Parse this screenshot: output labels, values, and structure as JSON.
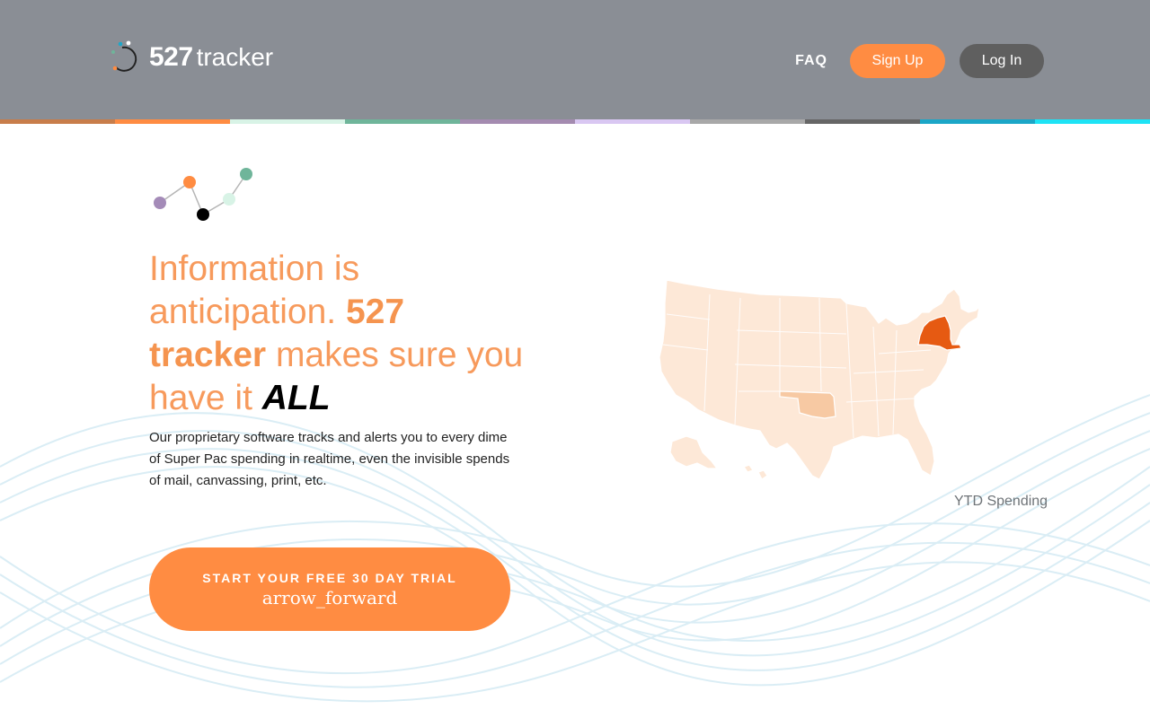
{
  "header": {
    "logo_number": "527",
    "logo_word": "tracker",
    "nav": {
      "faq": "FAQ",
      "signup": "Sign Up",
      "login": "Log In"
    }
  },
  "colors": {
    "header_bg": "#8a8e95",
    "accent": "#ff8c42",
    "login_bg": "#5f5f5f",
    "highlight_state": "#e65a12",
    "medium_state": "#f7c9a3",
    "base_state": "#fde8d7",
    "stripe": [
      "#c87d4a",
      "#ff8c42",
      "#d8f3e6",
      "#6fb59a",
      "#a48bb0",
      "#d9c7f2",
      "#a8a8a8",
      "#666666",
      "#1ba6c7",
      "#1de3f5"
    ]
  },
  "hero": {
    "headline_1": "Information is anticipation. ",
    "headline_strong": "527 tracker",
    "headline_2": " makes sure you have it ",
    "headline_all": "ALL",
    "description": "Our proprietary software tracks and alerts you to every dime of Super Pac spending in realtime, even the invisible spends of mail, canvassing, print, etc.",
    "cta_label": "START YOUR FREE 30 DAY TRIAL",
    "cta_icon": "arrow_forward"
  },
  "map": {
    "caption": "YTD Spending",
    "highlighted_state": "New York",
    "medium_state": "Oklahoma"
  },
  "icons": [
    "logo-ring-icon",
    "network-dots-icon",
    "us-map-icon",
    "arrow-forward-icon"
  ]
}
